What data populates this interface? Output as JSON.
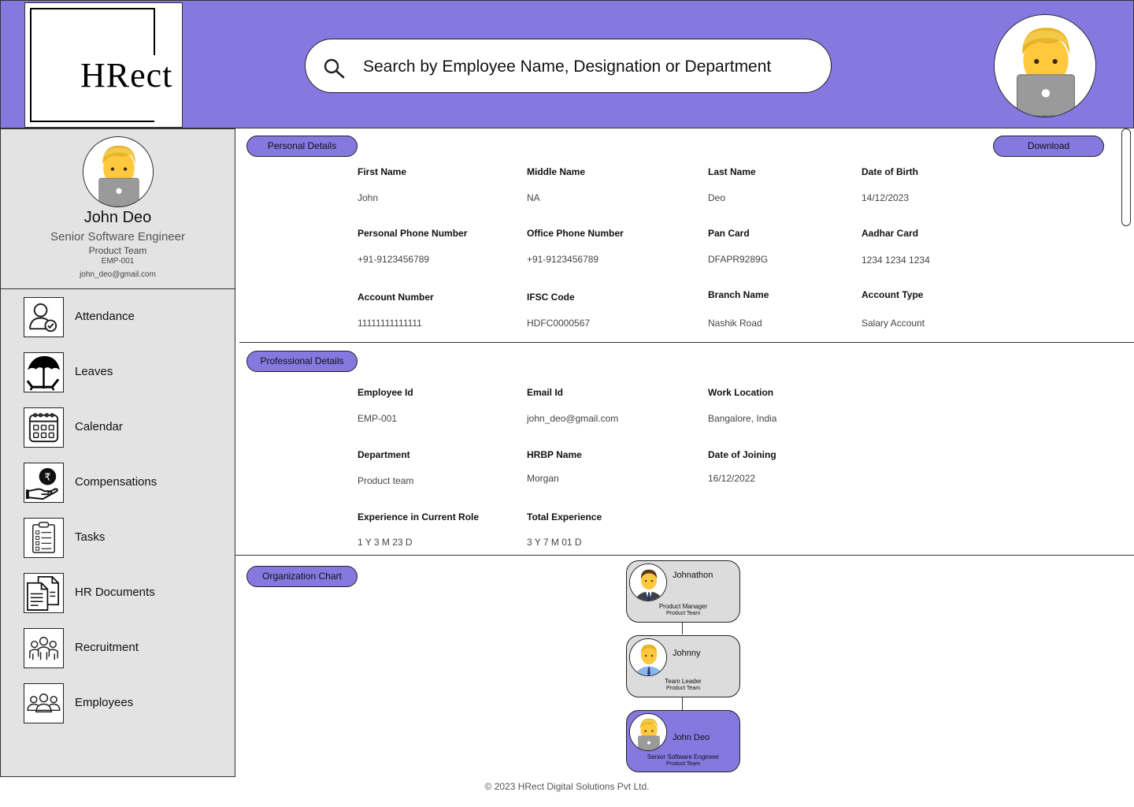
{
  "app": {
    "logo_text": "HRect"
  },
  "search": {
    "placeholder": "Search by Employee Name, Designation or Department"
  },
  "profile": {
    "name": "John Deo",
    "designation": "Senior Software Engineer",
    "team": "Product Team",
    "employee_id": "EMP-001",
    "email": "john_deo@gmail.com"
  },
  "nav": {
    "items": [
      {
        "label": "Attendance",
        "icon": "attendance-icon"
      },
      {
        "label": "Leaves",
        "icon": "leaves-icon"
      },
      {
        "label": "Calendar",
        "icon": "calendar-icon"
      },
      {
        "label": "Compensations",
        "icon": "compensation-icon"
      },
      {
        "label": "Tasks",
        "icon": "tasks-icon"
      },
      {
        "label": "HR Documents",
        "icon": "documents-icon"
      },
      {
        "label": "Recruitment",
        "icon": "recruitment-icon"
      },
      {
        "label": "Employees",
        "icon": "employees-icon"
      }
    ]
  },
  "personal": {
    "title": "Personal Details",
    "download_label": "Download",
    "fields": [
      {
        "label": "First Name",
        "value": "John"
      },
      {
        "label": "Middle Name",
        "value": "NA"
      },
      {
        "label": "Last Name",
        "value": "Deo"
      },
      {
        "label": "Date of Birth",
        "value": "14/12/2023"
      },
      {
        "label": "Personal Phone Number",
        "value": "+91-9123456789"
      },
      {
        "label": "Office Phone Number",
        "value": "+91-9123456789"
      },
      {
        "label": "Pan Card",
        "value": "DFAPR9289G"
      },
      {
        "label": "Aadhar Card",
        "value": "1234 1234 1234"
      },
      {
        "label": "Account Number",
        "value": "11111111111111"
      },
      {
        "label": "IFSC Code",
        "value": "HDFC0000567"
      },
      {
        "label": "Branch Name",
        "value": "Nashik Road"
      },
      {
        "label": "Account Type",
        "value": "Salary Account"
      }
    ]
  },
  "professional": {
    "title": "Professional Details",
    "fields": [
      {
        "label": "Employee Id",
        "value": "EMP-001"
      },
      {
        "label": "Email Id",
        "value": "john_deo@gmail.com"
      },
      {
        "label": "Work Location",
        "value": "Bangalore, India"
      },
      {
        "label": "Department",
        "value": "Product team"
      },
      {
        "label": "HRBP Name",
        "value": "Morgan"
      },
      {
        "label": "Date of Joining",
        "value": "16/12/2022"
      },
      {
        "label": "Experience in Current Role",
        "value": "1 Y 3 M 23 D"
      },
      {
        "label": "Total Experience",
        "value": "3 Y 7 M 01 D"
      }
    ]
  },
  "org": {
    "title": "Organization Chart",
    "nodes": [
      {
        "name": "Johnathon",
        "role": "Product Manager",
        "team": "Product Team",
        "active": false
      },
      {
        "name": "Johnny",
        "role": "Team Leader",
        "team": "Product Team",
        "active": false
      },
      {
        "name": "John Deo",
        "role": "Senior Software Engineer",
        "team": "Product Team",
        "active": true
      }
    ]
  },
  "footer": {
    "text": "© 2023 HRect Digital Solutions Pvt Ltd."
  },
  "colors": {
    "accent": "#8579e0",
    "sidebar": "#e3e3e3"
  }
}
